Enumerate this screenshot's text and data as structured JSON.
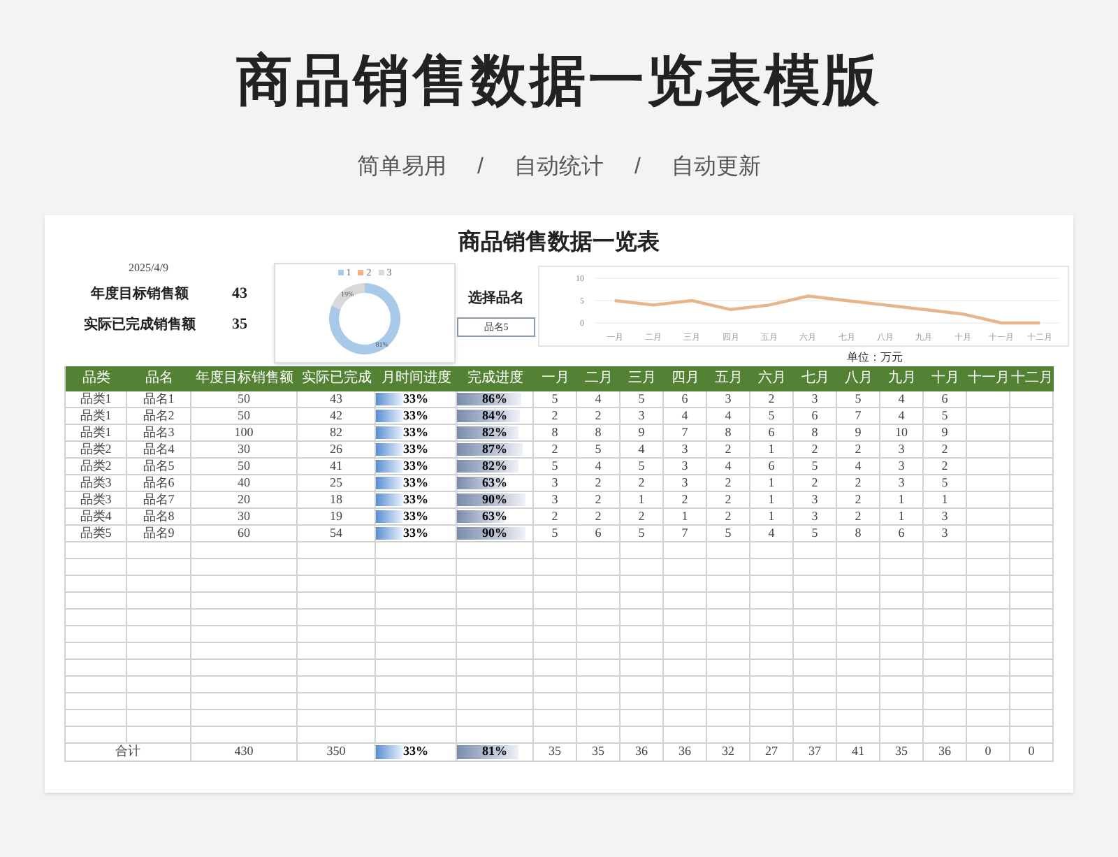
{
  "header": {
    "title": "商品销售数据一览表模版",
    "tags": [
      "简单易用",
      "自动统计",
      "自动更新"
    ],
    "separators": [
      "/",
      "/"
    ]
  },
  "sheet": {
    "title": "商品销售数据一览表",
    "date": "2025/4/9",
    "summary": [
      {
        "label": "年度目标销售额",
        "value": "43"
      },
      {
        "label": "实际已完成销售额",
        "value": "35"
      }
    ],
    "donut": {
      "slices": [
        {
          "color": "#a9c9e8"
        },
        {
          "color": "#f4b183"
        },
        {
          "color": "#d9d9d9"
        }
      ],
      "chart_data": {
        "type": "donut",
        "categories": [
          "1",
          "2",
          "3"
        ],
        "values": [
          81,
          0,
          19
        ],
        "value_labels": [
          "81%",
          null,
          "19%"
        ],
        "legend": "top"
      }
    },
    "selector": {
      "label": "选择品名",
      "value": "品名5"
    },
    "line_chart": {
      "chart_data": {
        "type": "line",
        "categories": [
          "一月",
          "二月",
          "三月",
          "四月",
          "五月",
          "六月",
          "七月",
          "八月",
          "九月",
          "十月",
          "十一月",
          "十二月"
        ],
        "series": [
          {
            "color": "#e8b48a",
            "values": [
              5,
              4,
              5,
              3,
              4,
              6,
              5,
              4,
              3,
              2,
              0,
              0
            ]
          }
        ],
        "ylim": [
          0,
          10
        ],
        "yticks": [
          0,
          5,
          10
        ]
      }
    },
    "unit": "单位：万元",
    "table": {
      "columns": [
        "品类",
        "品名",
        "年度目标销售额",
        "实际已完成",
        "月时间进度",
        "完成进度",
        "一月",
        "二月",
        "三月",
        "四月",
        "五月",
        "六月",
        "七月",
        "八月",
        "九月",
        "十月",
        "十一月",
        "十二月"
      ],
      "rows": [
        {
          "category": "品类1",
          "name": "品名1",
          "target": "50",
          "actual": "43",
          "time_progress": {
            "text": "33%",
            "level": 0.33
          },
          "completion": {
            "text": "86%",
            "level": 0.86
          },
          "months": [
            "5",
            "4",
            "5",
            "6",
            "3",
            "2",
            "3",
            "5",
            "4",
            "6"
          ]
        },
        {
          "category": "品类1",
          "name": "品名2",
          "target": "50",
          "actual": "42",
          "time_progress": {
            "text": "33%",
            "level": 0.33
          },
          "completion": {
            "text": "84%",
            "level": 0.84
          },
          "months": [
            "2",
            "2",
            "3",
            "4",
            "4",
            "5",
            "6",
            "7",
            "4",
            "5"
          ]
        },
        {
          "category": "品类1",
          "name": "品名3",
          "target": "100",
          "actual": "82",
          "time_progress": {
            "text": "33%",
            "level": 0.33
          },
          "completion": {
            "text": "82%",
            "level": 0.82
          },
          "months": [
            "8",
            "8",
            "9",
            "7",
            "8",
            "6",
            "8",
            "9",
            "10",
            "9"
          ]
        },
        {
          "category": "品类2",
          "name": "品名4",
          "target": "30",
          "actual": "26",
          "time_progress": {
            "text": "33%",
            "level": 0.33
          },
          "completion": {
            "text": "87%",
            "level": 0.87
          },
          "months": [
            "2",
            "5",
            "4",
            "3",
            "2",
            "1",
            "2",
            "2",
            "3",
            "2"
          ]
        },
        {
          "category": "品类2",
          "name": "品名5",
          "target": "50",
          "actual": "41",
          "time_progress": {
            "text": "33%",
            "level": 0.33
          },
          "completion": {
            "text": "82%",
            "level": 0.82
          },
          "months": [
            "5",
            "4",
            "5",
            "3",
            "4",
            "6",
            "5",
            "4",
            "3",
            "2"
          ]
        },
        {
          "category": "品类3",
          "name": "品名6",
          "target": "40",
          "actual": "25",
          "time_progress": {
            "text": "33%",
            "level": 0.33
          },
          "completion": {
            "text": "63%",
            "level": 0.63
          },
          "months": [
            "3",
            "2",
            "2",
            "3",
            "2",
            "1",
            "2",
            "2",
            "3",
            "5"
          ]
        },
        {
          "category": "品类3",
          "name": "品名7",
          "target": "20",
          "actual": "18",
          "time_progress": {
            "text": "33%",
            "level": 0.33
          },
          "completion": {
            "text": "90%",
            "level": 0.9
          },
          "months": [
            "3",
            "2",
            "1",
            "2",
            "2",
            "1",
            "3",
            "2",
            "1",
            "1"
          ]
        },
        {
          "category": "品类4",
          "name": "品名8",
          "target": "30",
          "actual": "19",
          "time_progress": {
            "text": "33%",
            "level": 0.33
          },
          "completion": {
            "text": "63%",
            "level": 0.63
          },
          "months": [
            "2",
            "2",
            "2",
            "1",
            "2",
            "1",
            "3",
            "2",
            "1",
            "3"
          ]
        },
        {
          "category": "品类5",
          "name": "品名9",
          "target": "60",
          "actual": "54",
          "time_progress": {
            "text": "33%",
            "level": 0.33
          },
          "completion": {
            "text": "90%",
            "level": 0.9
          },
          "months": [
            "5",
            "6",
            "5",
            "7",
            "5",
            "4",
            "5",
            "8",
            "6",
            "3"
          ]
        }
      ],
      "total": {
        "label": "合计",
        "target": "430",
        "actual": "350",
        "time_progress": {
          "text": "33%",
          "level": 0.33
        },
        "completion": {
          "text": "81%",
          "level": 0.81
        },
        "months": [
          "35",
          "35",
          "36",
          "36",
          "32",
          "27",
          "37",
          "41",
          "35",
          "36",
          "0",
          "0"
        ]
      }
    }
  }
}
